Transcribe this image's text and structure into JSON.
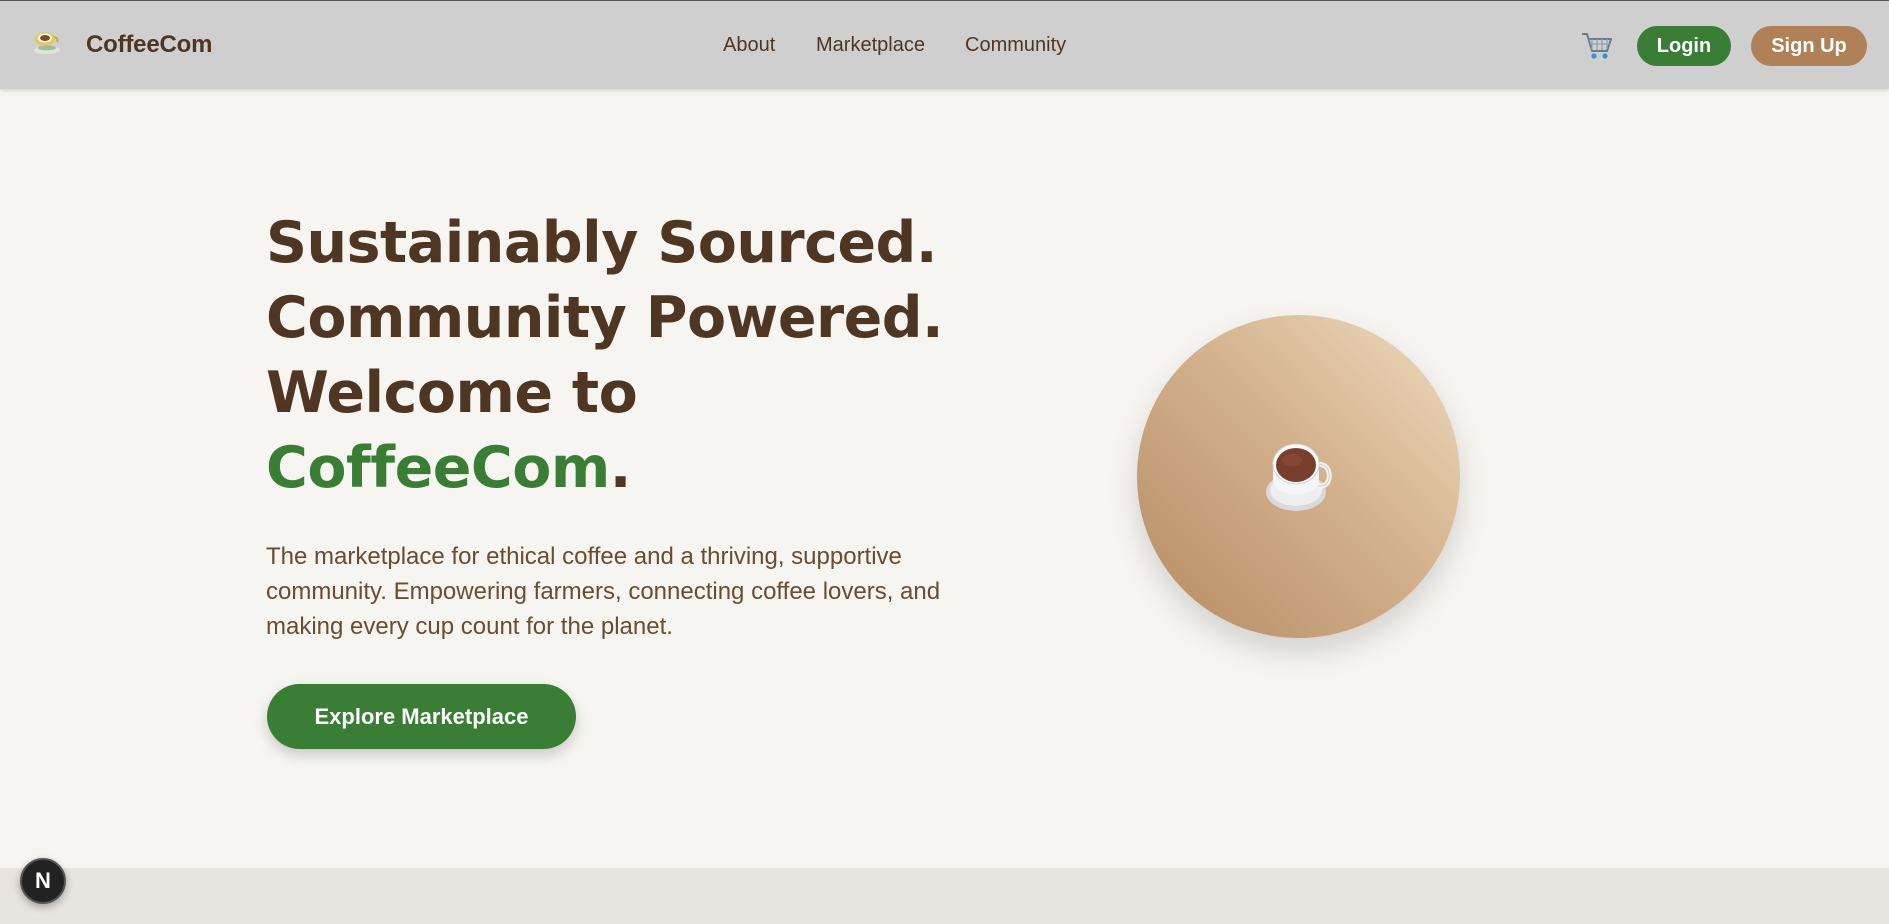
{
  "header": {
    "brand": "CoffeeCom",
    "nav": [
      "About",
      "Marketplace",
      "Community"
    ],
    "cart_icon": "shopping-cart-icon",
    "login_label": "Login",
    "signup_label": "Sign Up"
  },
  "hero": {
    "title_line1": "Sustainably Sourced.",
    "title_line2": "Community Powered.",
    "title_line3": "Welcome to",
    "title_brand": "CoffeeCom",
    "title_period": ".",
    "description": "The marketplace for ethical coffee and a thriving, supportive community. Empowering farmers, connecting coffee lovers, and making every cup count for the planet.",
    "cta_label": "Explore Marketplace",
    "image_icon": "coffee-cup-icon"
  },
  "devtools": {
    "badge_label": "N"
  },
  "colors": {
    "header_bg": "#cfcfcf",
    "page_bg": "#f6f5f1",
    "brown_text": "#4e3622",
    "brand_green": "#3a7d35",
    "signup_tan": "#b08156"
  }
}
